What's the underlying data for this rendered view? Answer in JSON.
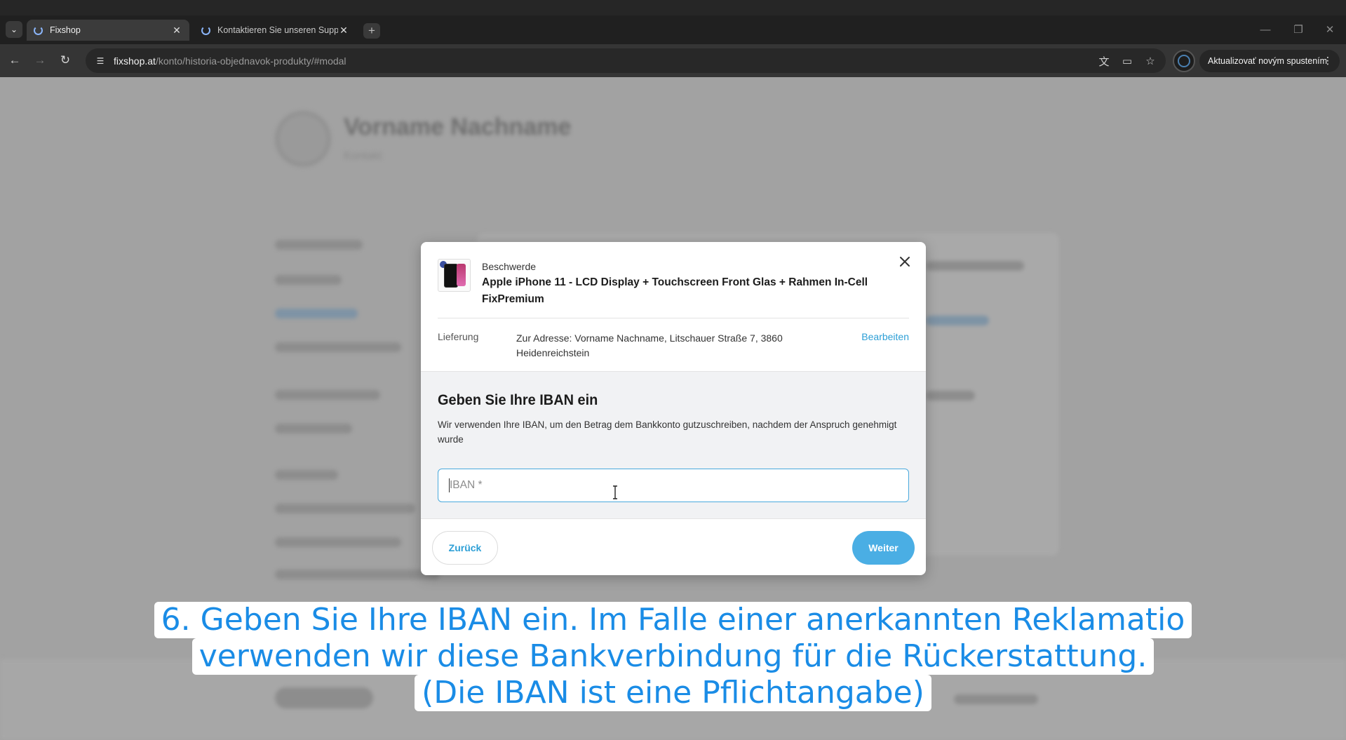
{
  "browser": {
    "tabs": [
      {
        "title": "Fixshop",
        "active": true
      },
      {
        "title": "Kontaktieren Sie unseren Supp",
        "active": false
      }
    ],
    "url_host": "fixshop.at",
    "url_path": "/konto/historia-objednavok-produkty/#modal",
    "update_label": "Aktualizovať novým spustením"
  },
  "background": {
    "user_name": "Vorname Nachname",
    "user_sub": "Kontakt"
  },
  "modal": {
    "kicker": "Beschwerde",
    "product_title": "Apple iPhone 11 - LCD Display + Touchscreen Front Glas + Rahmen In-Cell FixPremium",
    "delivery_label": "Lieferung",
    "delivery_value": "Zur Adresse: Vorname Nachname, Litschauer Straße 7, 3860 Heidenreichstein",
    "edit_label": "Bearbeiten",
    "section_title": "Geben Sie Ihre IBAN ein",
    "section_desc": "Wir verwenden Ihre IBAN, um den Betrag dem Bankkonto gutzuschreiben, nachdem der Anspruch genehmigt wurde",
    "iban_placeholder": "IBAN *",
    "back_label": "Zurück",
    "next_label": "Weiter"
  },
  "caption": {
    "line1": "6. Geben Sie Ihre IBAN ein. Im Falle einer anerkannten Reklamatio",
    "line2": "verwenden wir diese Bankverbindung für die Rückerstattung.",
    "line3": "(Die IBAN ist eine Pflichtangabe)"
  },
  "colors": {
    "accent": "#2d9fd6",
    "primary_button": "#4aaee4",
    "caption_text": "#1a8ce6"
  }
}
